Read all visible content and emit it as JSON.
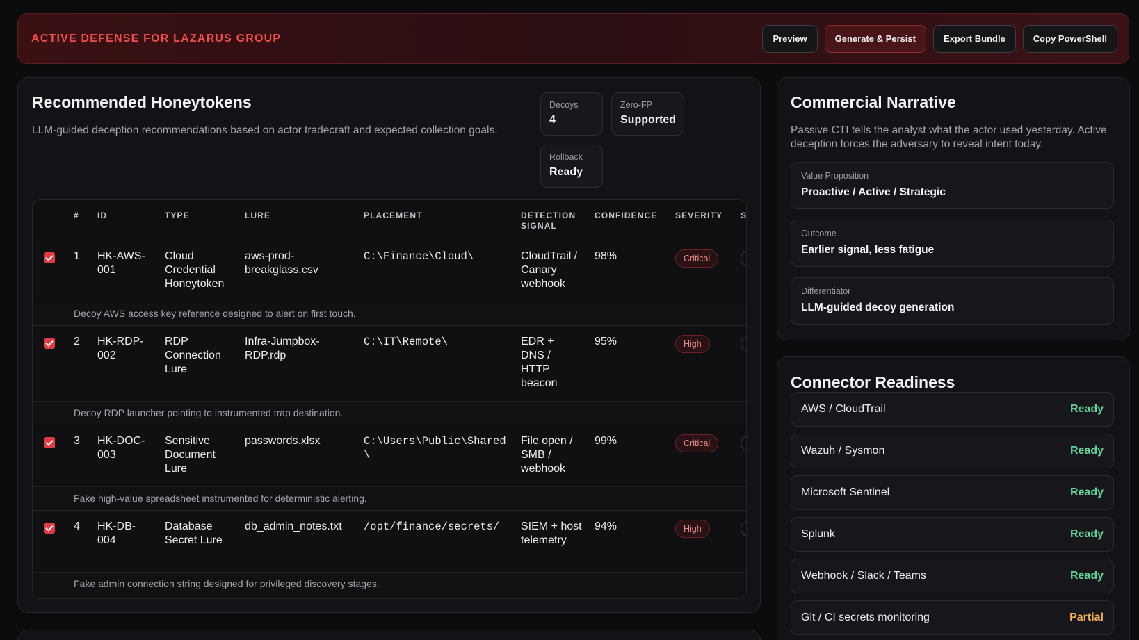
{
  "header": {
    "title": "ACTIVE DEFENSE FOR LAZARUS GROUP",
    "buttons": [
      "Preview",
      "Generate & Persist",
      "Export Bundle",
      "Copy PowerShell"
    ]
  },
  "honeytokens": {
    "title": "Recommended Honeytokens",
    "subtitle": "LLM-guided deception recommendations based on actor tradecraft and expected collection goals.",
    "stats": [
      {
        "label": "Decoys",
        "value": "4"
      },
      {
        "label": "Zero-FP",
        "value": "Supported"
      },
      {
        "label": "Rollback",
        "value": "Ready"
      }
    ],
    "columns": [
      "#",
      "ID",
      "TYPE",
      "LURE",
      "PLACEMENT",
      "DETECTION SIGNAL",
      "CONFIDENCE",
      "SEVERITY",
      "S"
    ],
    "rows": [
      {
        "num": "1",
        "id": "HK-AWS-001",
        "type": "Cloud Credential Honeytoken",
        "lure": "aws-prod-breakglass.csv",
        "placement": "C:\\Finance\\Cloud\\",
        "signal": "CloudTrail / Canary webhook",
        "confidence": "98%",
        "severity": "Critical",
        "note": "Decoy AWS access key reference designed to alert on first touch."
      },
      {
        "num": "2",
        "id": "HK-RDP-002",
        "type": "RDP Connection Lure",
        "lure": "Infra-Jumpbox-RDP.rdp",
        "placement": "C:\\IT\\Remote\\",
        "signal": "EDR + DNS / HTTP beacon",
        "confidence": "95%",
        "severity": "High",
        "note": "Decoy RDP launcher pointing to instrumented trap destination."
      },
      {
        "num": "3",
        "id": "HK-DOC-003",
        "type": "Sensitive Document Lure",
        "lure": "passwords.xlsx",
        "placement": "C:\\Users\\Public\\Shared\\",
        "signal": "File open / SMB / webhook",
        "confidence": "99%",
        "severity": "Critical",
        "note": "Fake high-value spreadsheet instrumented for deterministic alerting."
      },
      {
        "num": "4",
        "id": "HK-DB-004",
        "type": "Database Secret Lure",
        "lure": "db_admin_notes.txt",
        "placement": "/opt/finance/secrets/",
        "signal": "SIEM + host telemetry",
        "confidence": "94%",
        "severity": "High",
        "note": "Fake admin connection string designed for privileged discovery stages."
      }
    ]
  },
  "narrative": {
    "title": "Commercial Narrative",
    "subtitle": "Passive CTI tells the analyst what the actor used yesterday. Active deception forces the adversary to reveal intent today.",
    "items": [
      {
        "label": "Value Proposition",
        "value": "Proactive / Active / Strategic"
      },
      {
        "label": "Outcome",
        "value": "Earlier signal, less fatigue"
      },
      {
        "label": "Differentiator",
        "value": "LLM-guided decoy generation"
      }
    ]
  },
  "connectors": {
    "title": "Connector Readiness",
    "items": [
      {
        "name": "AWS / CloudTrail",
        "status": "Ready"
      },
      {
        "name": "Wazuh / Sysmon",
        "status": "Ready"
      },
      {
        "name": "Microsoft Sentinel",
        "status": "Ready"
      },
      {
        "name": "Splunk",
        "status": "Ready"
      },
      {
        "name": "Webhook / Slack / Teams",
        "status": "Ready"
      },
      {
        "name": "Git / CI secrets monitoring",
        "status": "Partial"
      }
    ]
  },
  "colors": {
    "accent": "#ef4d4d",
    "ready": "#5fd39a",
    "partial": "#f0b35a",
    "checkbox": "#e23b46"
  }
}
